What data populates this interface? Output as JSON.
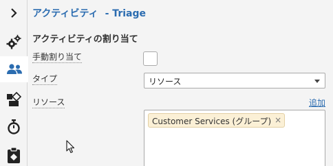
{
  "sidebar": {
    "items": [
      {
        "name": "expand",
        "icon": "chevron-right-icon"
      },
      {
        "name": "settings",
        "icon": "gears-icon"
      },
      {
        "name": "users",
        "icon": "users-icon",
        "active": true
      },
      {
        "name": "shapes",
        "icon": "shapes-icon"
      },
      {
        "name": "timer",
        "icon": "stopwatch-icon"
      },
      {
        "name": "clipboard",
        "icon": "clipboard-icon"
      }
    ]
  },
  "header": {
    "title_part1": "アクティビティ",
    "title_part2": "- Triage"
  },
  "section": {
    "title": "アクティビティの割り当て"
  },
  "form": {
    "manual_label": "手動割り当て",
    "manual_checked": false,
    "type_label": "タイプ",
    "type_value": "リソース",
    "resource_label": "リソース",
    "add_link": "追加",
    "tags": [
      {
        "label": "Customer Services (グループ)",
        "remove": "×"
      }
    ]
  },
  "colors": {
    "accent": "#2b6cb0",
    "tag_bg": "#fbf0d6"
  }
}
